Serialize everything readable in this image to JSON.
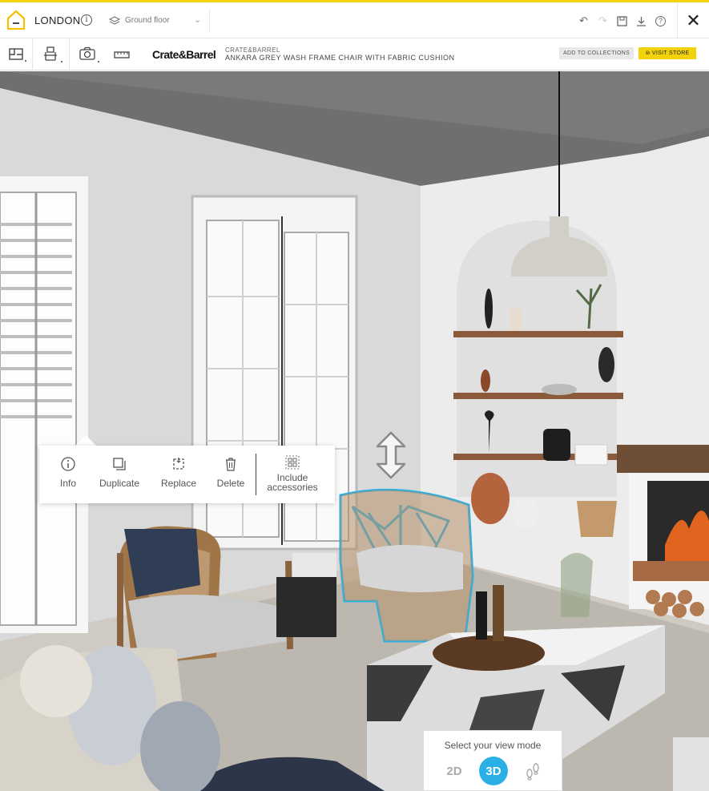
{
  "header": {
    "project_title": "LONDON",
    "floor": "Ground floor"
  },
  "toolbar": {
    "brand_logo": "Crate&Barrel",
    "product_brand": "CRATE&BARREL",
    "product_name": "ANKARA GREY WASH FRAME CHAIR WITH FABRIC CUSHION",
    "add_to_collections": "ADD TO COLLECTIONS",
    "visit_store": "VISIT STORE"
  },
  "context_menu": {
    "items": [
      {
        "label": "Info",
        "icon": "info-icon"
      },
      {
        "label": "Duplicate",
        "icon": "duplicate-icon"
      },
      {
        "label": "Replace",
        "icon": "replace-icon"
      },
      {
        "label": "Delete",
        "icon": "trash-icon"
      },
      {
        "label_line1": "Include",
        "label_line2": "accessories",
        "icon": "accessories-icon"
      }
    ]
  },
  "view_mode": {
    "title": "Select your view mode",
    "options": [
      "2D",
      "3D"
    ],
    "selected": "3D"
  },
  "colors": {
    "accent_yellow": "#f2d20b",
    "selection_blue": "#2ab0e5"
  }
}
